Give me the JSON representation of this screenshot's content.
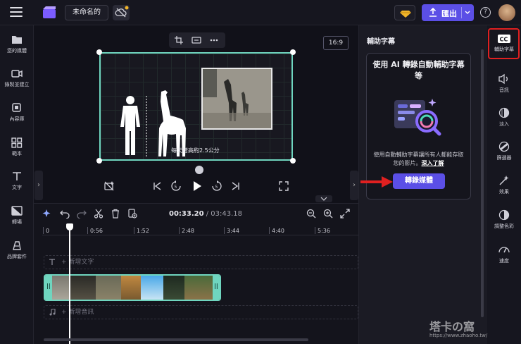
{
  "header": {
    "project_title": "未命名的",
    "export_label": "匯出"
  },
  "left_sidebar": {
    "items": [
      {
        "label": "您的媒體",
        "icon": "folder-icon"
      },
      {
        "label": "錄製並建立",
        "icon": "video-camera-icon"
      },
      {
        "label": "內容庫",
        "icon": "content-library-icon"
      },
      {
        "label": "範本",
        "icon": "templates-icon"
      },
      {
        "label": "文字",
        "icon": "text-icon"
      },
      {
        "label": "轉場",
        "icon": "transition-icon"
      },
      {
        "label": "品牌套件",
        "icon": "brand-kit-icon"
      }
    ]
  },
  "stage": {
    "aspect_ratio": "16:9",
    "caption_text": "每天增高約2.5公分"
  },
  "timeline": {
    "current_time": "00:33.20",
    "separator": " / ",
    "total_time": "03:43.18",
    "ruler_ticks": [
      "0",
      "0:56",
      "1:52",
      "2:48",
      "3:44",
      "4:40",
      "5:36"
    ],
    "add_text_placeholder": "+ 新增文字",
    "add_audio_placeholder": "+ 新增音訊"
  },
  "captions_panel": {
    "title": "輔助字幕",
    "card_title": "使用 AI 轉錄自動輔助字幕等",
    "description": "使用自動輔助字幕讓所有人都能存取您的影片。",
    "learn_more": "深入了解",
    "transcribe_button": "轉錄媒體"
  },
  "right_sidebar": {
    "items": [
      {
        "label": "輔助字幕",
        "icon": "cc-icon"
      },
      {
        "label": "音訊",
        "icon": "speaker-icon"
      },
      {
        "label": "淡入",
        "icon": "fade-icon"
      },
      {
        "label": "篩選器",
        "icon": "filters-icon"
      },
      {
        "label": "效果",
        "icon": "effects-icon"
      },
      {
        "label": "調整色彩",
        "icon": "adjust-color-icon"
      },
      {
        "label": "速度",
        "icon": "speed-icon"
      }
    ]
  },
  "watermark": {
    "brand": "塔卡の窩",
    "url": "https://www.zhaoho.tw/"
  },
  "colors": {
    "accent": "#5b4fe6",
    "selection": "#6fd5bf",
    "highlight": "#e02020"
  }
}
